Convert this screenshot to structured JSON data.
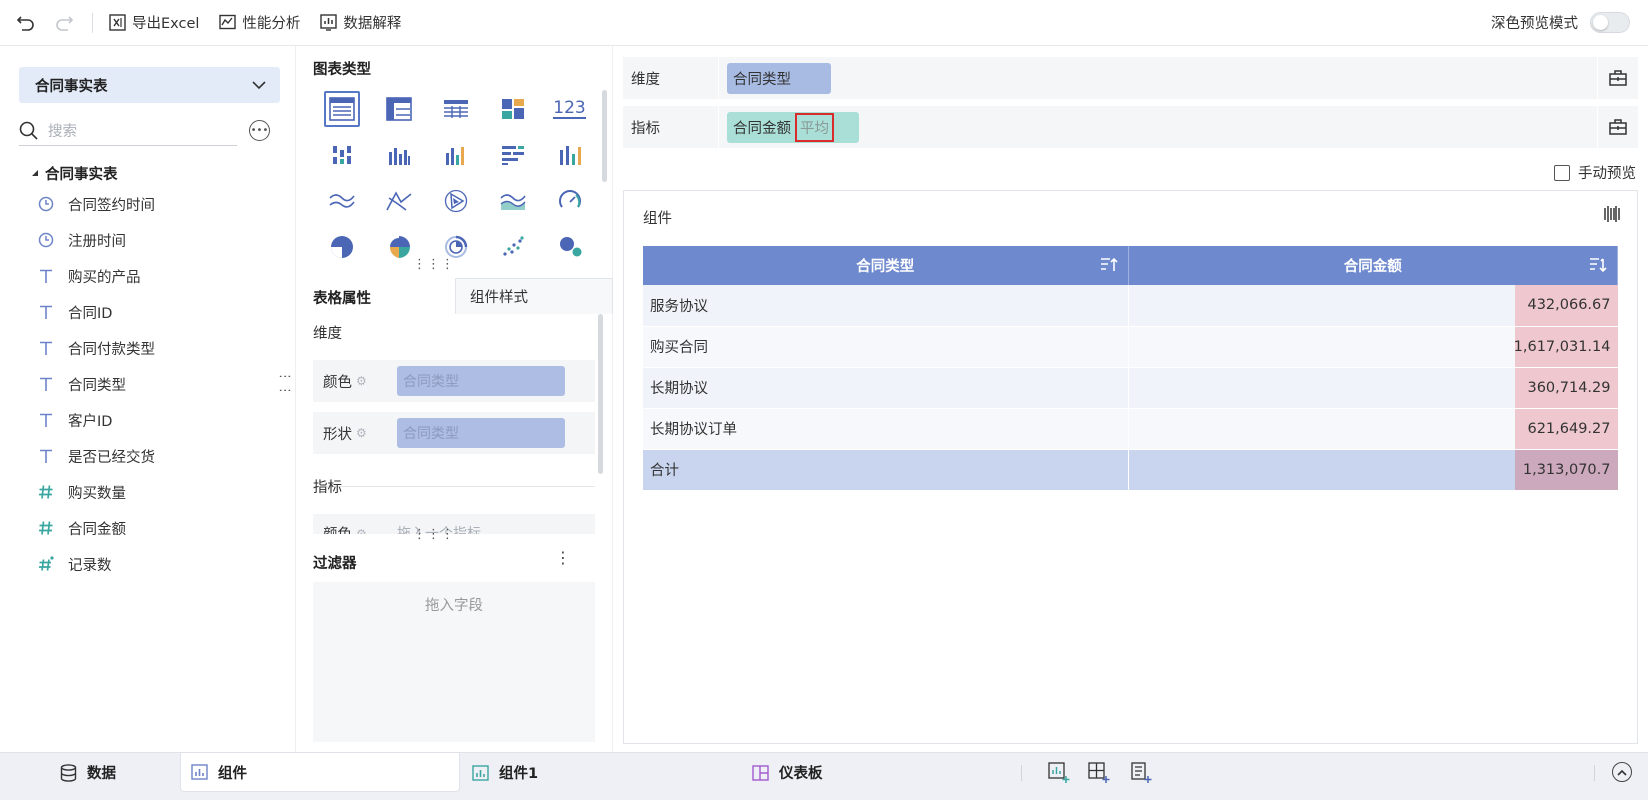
{
  "toolbar": {
    "undo_icon": "undo-icon",
    "redo_icon": "redo-icon",
    "export_label": "导出Excel",
    "perf_label": "性能分析",
    "explain_label": "数据解释",
    "dark_mode_label": "深色预览模式",
    "dark_mode_on": false
  },
  "data_panel": {
    "table_name": "合同事实表",
    "search_placeholder": "搜索",
    "tree_root": "合同事实表",
    "fields": [
      {
        "icon": "clock-icon",
        "label": "合同签约时间"
      },
      {
        "icon": "clock-icon",
        "label": "注册时间"
      },
      {
        "icon": "text-icon",
        "label": "购买的产品"
      },
      {
        "icon": "text-icon",
        "label": "合同ID"
      },
      {
        "icon": "text-icon",
        "label": "合同付款类型"
      },
      {
        "icon": "text-icon",
        "label": "合同类型"
      },
      {
        "icon": "text-icon",
        "label": "客户ID"
      },
      {
        "icon": "text-icon",
        "label": "是否已经交货"
      },
      {
        "icon": "number-icon",
        "label": "购买数量"
      },
      {
        "icon": "number-icon",
        "label": "合同金额"
      },
      {
        "icon": "number-star-icon",
        "label": "记录数"
      }
    ]
  },
  "config_panel": {
    "chart_types_title": "图表类型",
    "tab_table_props": "表格属性",
    "tab_component_style": "组件样式",
    "dimension_label": "维度",
    "color_label": "颜色",
    "color_value": "合同类型",
    "shape_label": "形状",
    "shape_value": "合同类型",
    "metric_label": "指标",
    "metric_color_label": "颜色",
    "metric_color_placeholder": "拖入一个指标",
    "filter_title": "过滤器",
    "filter_placeholder": "拖入字段"
  },
  "shelves": {
    "dimension_label": "维度",
    "dimension_chip": "合同类型",
    "metric_label": "指标",
    "metric_chip": "合同金额",
    "metric_agg": "平均",
    "manual_preview_label": "手动预览"
  },
  "component": {
    "title": "组件",
    "headers": [
      "合同类型",
      "合同金额"
    ],
    "rows": [
      {
        "type": "服务协议",
        "amount": "432,066.67"
      },
      {
        "type": "购买合同",
        "amount": "1,617,031.14"
      },
      {
        "type": "长期协议",
        "amount": "360,714.29"
      },
      {
        "type": "长期协议订单",
        "amount": "621,649.27"
      }
    ],
    "total": {
      "label": "合计",
      "amount": "1,313,070.7"
    }
  },
  "bottom_tabs": {
    "data_label": "数据",
    "component_label": "组件",
    "component1_label": "组件1",
    "dashboard_label": "仪表板"
  },
  "colors": {
    "header_blue": "#6f89cf",
    "dim_chip": "#a8bbe3",
    "metric_chip": "#a9dfd6",
    "value_fill": "#efc8cf",
    "highlight_box": "#d92b2b"
  }
}
